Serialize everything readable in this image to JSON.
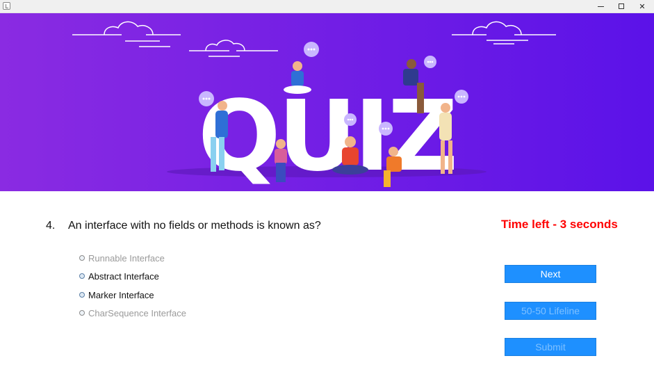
{
  "window": {
    "minimize_glyph": "–",
    "close_glyph": "✕"
  },
  "banner": {
    "title": "QUIZ",
    "colors": {
      "left": "#8a2be2",
      "right": "#5b12e8"
    }
  },
  "question": {
    "number": "4.",
    "text": "An interface with no fields or methods is known as?"
  },
  "timer": {
    "text": "Time left - 3 seconds",
    "color": "#ff0000"
  },
  "options": [
    {
      "label": "Runnable Interface",
      "enabled": false
    },
    {
      "label": "Abstract Interface",
      "enabled": true
    },
    {
      "label": "Marker Interface",
      "enabled": true
    },
    {
      "label": "CharSequence Interface",
      "enabled": false
    }
  ],
  "buttons": {
    "next": "Next",
    "lifeline": "50-50 Lifeline",
    "submit": "Submit",
    "color": "#1e90ff"
  }
}
